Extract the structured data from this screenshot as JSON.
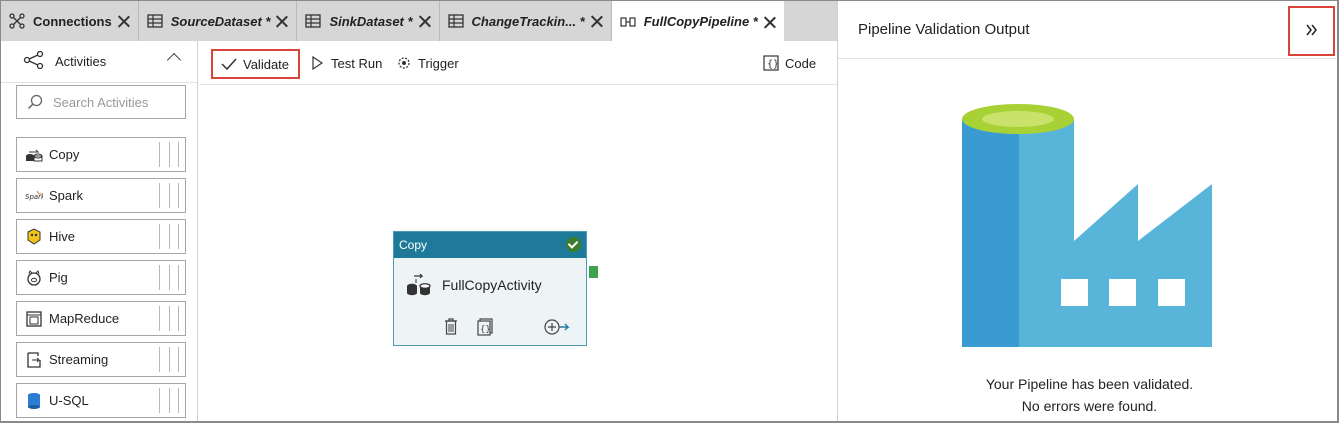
{
  "tabs": [
    {
      "label": "Connections",
      "icon": "connections-icon"
    },
    {
      "label": "SourceDataset *",
      "icon": "table-icon"
    },
    {
      "label": "SinkDataset *",
      "icon": "table-icon"
    },
    {
      "label": "ChangeTrackin... *",
      "icon": "table-icon"
    },
    {
      "label": "FullCopyPipeline *",
      "icon": "pipeline-icon",
      "active": true
    }
  ],
  "sidebar": {
    "title": "Activities",
    "search_placeholder": "Search Activities",
    "activities": [
      {
        "label": "Copy",
        "icon": "copy-icon"
      },
      {
        "label": "Spark",
        "icon": "spark-icon"
      },
      {
        "label": "Hive",
        "icon": "hive-icon"
      },
      {
        "label": "Pig",
        "icon": "pig-icon"
      },
      {
        "label": "MapReduce",
        "icon": "mapreduce-icon"
      },
      {
        "label": "Streaming",
        "icon": "streaming-icon"
      },
      {
        "label": "U-SQL",
        "icon": "usql-icon"
      }
    ]
  },
  "toolbar": {
    "validate": "Validate",
    "test_run": "Test Run",
    "trigger": "Trigger",
    "code": "Code"
  },
  "canvas": {
    "node": {
      "type": "Copy",
      "name": "FullCopyActivity"
    }
  },
  "panel": {
    "title": "Pipeline Validation Output",
    "message_line1": "Your Pipeline has been validated.",
    "message_line2": "No errors were found."
  },
  "colors": {
    "accent_red": "#d9453b",
    "node_header": "#1f7a99",
    "factory_dark": "#3a9bd2",
    "factory_light": "#59b4d9",
    "factory_top": "#a8d135"
  }
}
